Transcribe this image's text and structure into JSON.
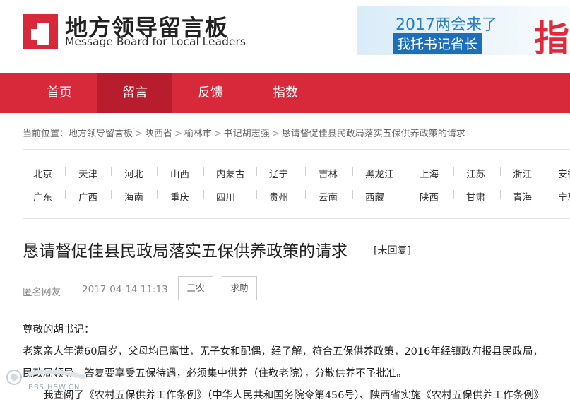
{
  "header": {
    "title": "地方领导留言板",
    "subtitle": "Message Board for Local Leaders",
    "banner": {
      "line1": "2017两会来了",
      "line2": "我托书记省长",
      "big_char": "指"
    }
  },
  "nav": {
    "items": [
      "首页",
      "留言",
      "反馈",
      "指数"
    ],
    "active_index": 1
  },
  "breadcrumb": {
    "prefix": "当前位置：",
    "items": [
      "地方领导留言板",
      "陕西省",
      "榆林市",
      "书记胡志强",
      "恳请督促佳县民政局落实五保供养政策的请求"
    ]
  },
  "provinces": {
    "row1": [
      "北京",
      "天津",
      "河北",
      "山西",
      "内蒙古",
      "辽宁",
      "吉林",
      "黑龙江",
      "上海",
      "江苏",
      "浙江",
      "安徽"
    ],
    "row2": [
      "广东",
      "广西",
      "海南",
      "重庆",
      "四川",
      "贵州",
      "云南",
      "西藏",
      "陕西",
      "甘肃",
      "青海",
      "宁夏"
    ]
  },
  "post": {
    "title": "恳请督促佳县民政局落实五保供养政策的请求",
    "status": "[未回复]",
    "author": "匿名网友",
    "time": "2017-04-14 11:13",
    "tags": [
      "三农",
      "求助"
    ],
    "content": [
      "尊敬的胡书记：",
      "老家亲人年满60周岁，父母均已离世，无子女和配偶，经了解，符合五保供养政策，2016年经镇政府报县民政局，",
      "民政局领导，答复要享受五保待遇，必须集中供养（住敬老院），分散供养不予批准。",
      "　　我查阅了《农村五保供养工作条例》（中华人民共和国务院令第456号）、陕西省实施《农村五保供养工作条例》"
    ]
  },
  "watermark": {
    "text": "BBS.HSW.CN"
  },
  "colors": {
    "nav_bg": "#d8293a",
    "nav_active": "#b81d2d",
    "logo_red": "#d8293a",
    "banner_blue": "#1c6fb8"
  }
}
